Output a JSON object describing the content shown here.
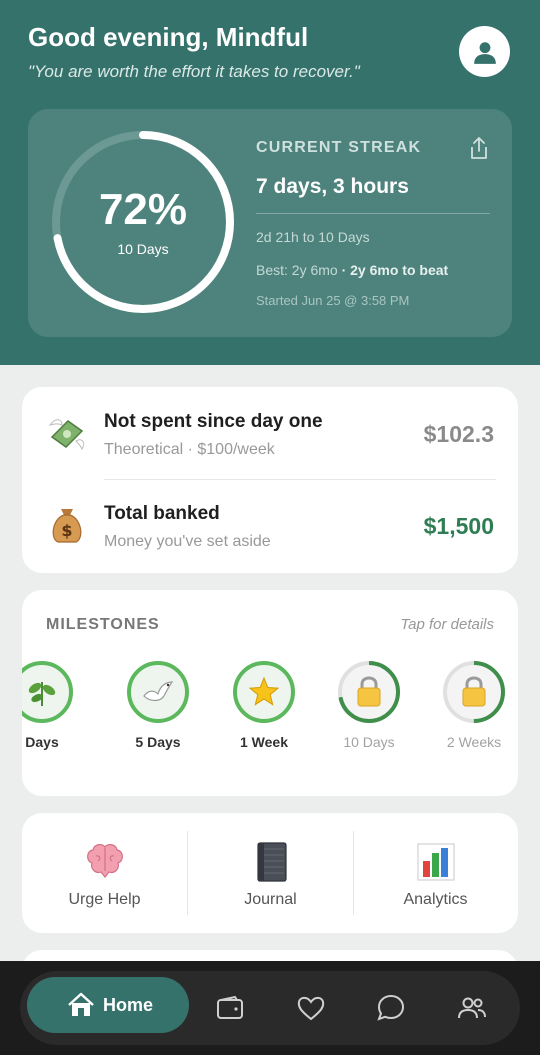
{
  "header": {
    "greeting": "Good evening, Mindful",
    "quote": "\"You are worth the effort it takes to recover.\""
  },
  "streak": {
    "percent_text": "72%",
    "percent_value": 0.72,
    "ring_sub": "10 Days",
    "label": "CURRENT STREAK",
    "value": "7 days, 3 hours",
    "range": "2d 21h to 10 Days",
    "best": "Best: 2y 6mo",
    "best_extra": "· 2y 6mo to beat",
    "started": "Started Jun 25 @ 3:58 PM"
  },
  "money": {
    "not_spent": {
      "title": "Not spent since day one",
      "subtitle": "Theoretical · $100/week",
      "amount": "$102.3",
      "amount_color": "#8a8a8a",
      "icon": "money-with-wings-icon"
    },
    "banked": {
      "title": "Total banked",
      "subtitle": "Money you've set aside",
      "amount": "$1,500",
      "amount_color": "#2f7d54",
      "icon": "money-bag-icon"
    }
  },
  "milestones": {
    "title": "MILESTONES",
    "hint": "Tap for details",
    "items": [
      {
        "label": "Days",
        "state": "done",
        "icon": "herb-icon",
        "progress": 1.0
      },
      {
        "label": "5 Days",
        "state": "done",
        "icon": "dove-icon",
        "progress": 1.0
      },
      {
        "label": "1 Week",
        "state": "done",
        "icon": "star-icon",
        "progress": 1.0
      },
      {
        "label": "10 Days",
        "state": "locked",
        "icon": "lock-icon",
        "progress": 0.72
      },
      {
        "label": "2 Weeks",
        "state": "locked",
        "icon": "lock-icon",
        "progress": 0.5
      }
    ]
  },
  "actions": [
    {
      "label": "Urge Help",
      "icon": "brain-icon"
    },
    {
      "label": "Journal",
      "icon": "notebook-icon"
    },
    {
      "label": "Analytics",
      "icon": "bar-chart-icon"
    }
  ],
  "nav": {
    "home_label": "Home",
    "items": [
      "wallet-icon",
      "heart-icon",
      "chat-icon",
      "people-icon"
    ]
  },
  "colors": {
    "brand": "#36726c",
    "milestone_green": "#5cb85c",
    "money_green": "#2f7d54"
  }
}
